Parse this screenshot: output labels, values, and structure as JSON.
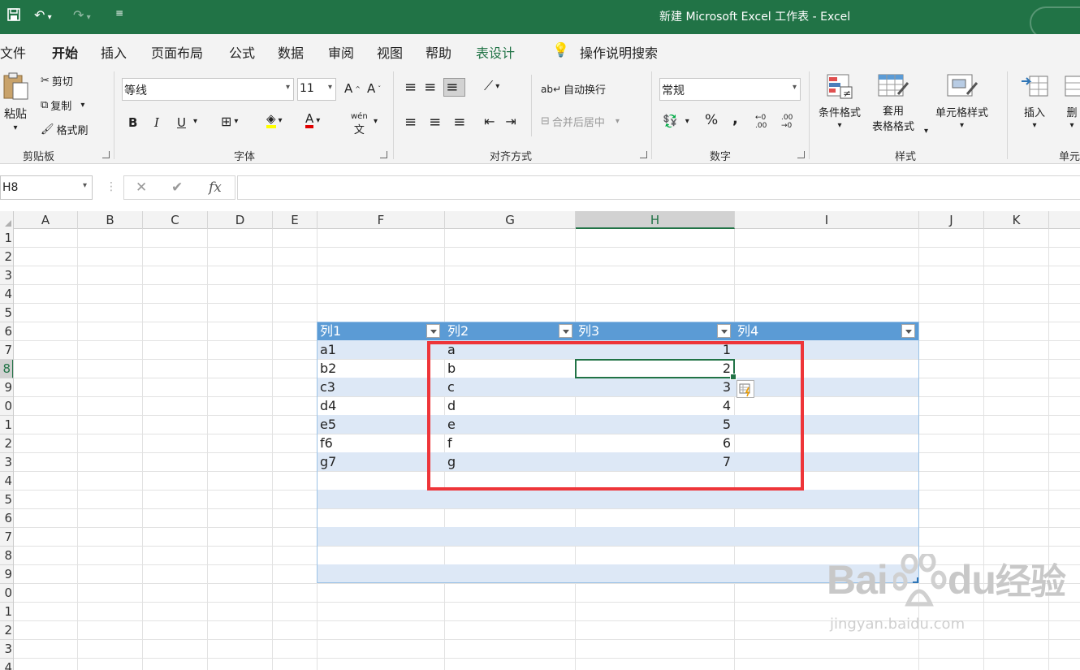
{
  "window": {
    "title": "新建 Microsoft Excel 工作表 - Excel"
  },
  "tabs": [
    {
      "label": "文件"
    },
    {
      "label": "开始"
    },
    {
      "label": "插入"
    },
    {
      "label": "页面布局"
    },
    {
      "label": "公式"
    },
    {
      "label": "数据"
    },
    {
      "label": "审阅"
    },
    {
      "label": "视图"
    },
    {
      "label": "帮助"
    },
    {
      "label": "表设计"
    }
  ],
  "search": {
    "label": "操作说明搜索"
  },
  "ribbon": {
    "clipboard": {
      "paste": "粘贴",
      "cut": "剪切",
      "copy": "复制",
      "format_painter": "格式刷",
      "group": "剪贴板"
    },
    "font": {
      "name": "等线",
      "size": "11",
      "bold": "B",
      "italic": "I",
      "underline": "U",
      "wen": "wén",
      "group": "字体"
    },
    "alignment": {
      "wrap": "自动换行",
      "merge": "合并后居中",
      "group": "对齐方式"
    },
    "number": {
      "format": "常规",
      "percent": "%",
      "comma": ",",
      "inc_dec": "←0 .00",
      "dec_dec": ".00 →0",
      "group": "数字"
    },
    "styles": {
      "conditional": "条件格式",
      "table_format_1": "套用",
      "table_format_2": "表格格式",
      "cell_styles": "单元格样式",
      "group": "样式"
    },
    "cells": {
      "insert": "插入",
      "delete": "删",
      "group": "单元"
    }
  },
  "formula_bar": {
    "name_box": "H8",
    "fx": "fx",
    "cancel": "✕",
    "enter": "✔"
  },
  "columns": [
    "A",
    "B",
    "C",
    "D",
    "E",
    "F",
    "G",
    "H",
    "I",
    "J",
    "K"
  ],
  "rows": [
    "1",
    "2",
    "3",
    "4",
    "5",
    "6",
    "7",
    "8",
    "9",
    "0",
    "1",
    "2",
    "3",
    "4",
    "5",
    "6",
    "7",
    "8",
    "9",
    "0",
    "1",
    "2",
    "3",
    "4"
  ],
  "table": {
    "headers": [
      "列1",
      "列2",
      "列3",
      "列4"
    ],
    "rows": [
      [
        "a1",
        "a",
        "1",
        ""
      ],
      [
        "b2",
        "b",
        "2",
        ""
      ],
      [
        "c3",
        "c",
        "3",
        ""
      ],
      [
        "d4",
        "d",
        "4",
        ""
      ],
      [
        "e5",
        "e",
        "5",
        ""
      ],
      [
        "f6",
        "f",
        "6",
        ""
      ],
      [
        "g7",
        "g",
        "7",
        ""
      ]
    ]
  },
  "watermark": {
    "brand": "Bai",
    "brand2": "du",
    "cn": "经验",
    "url": "jingyan.baidu.com"
  },
  "colors": {
    "excel_green": "#217346",
    "table_header": "#5b9bd5",
    "table_band": "#dde8f6",
    "annotation_red": "#ee3539"
  }
}
